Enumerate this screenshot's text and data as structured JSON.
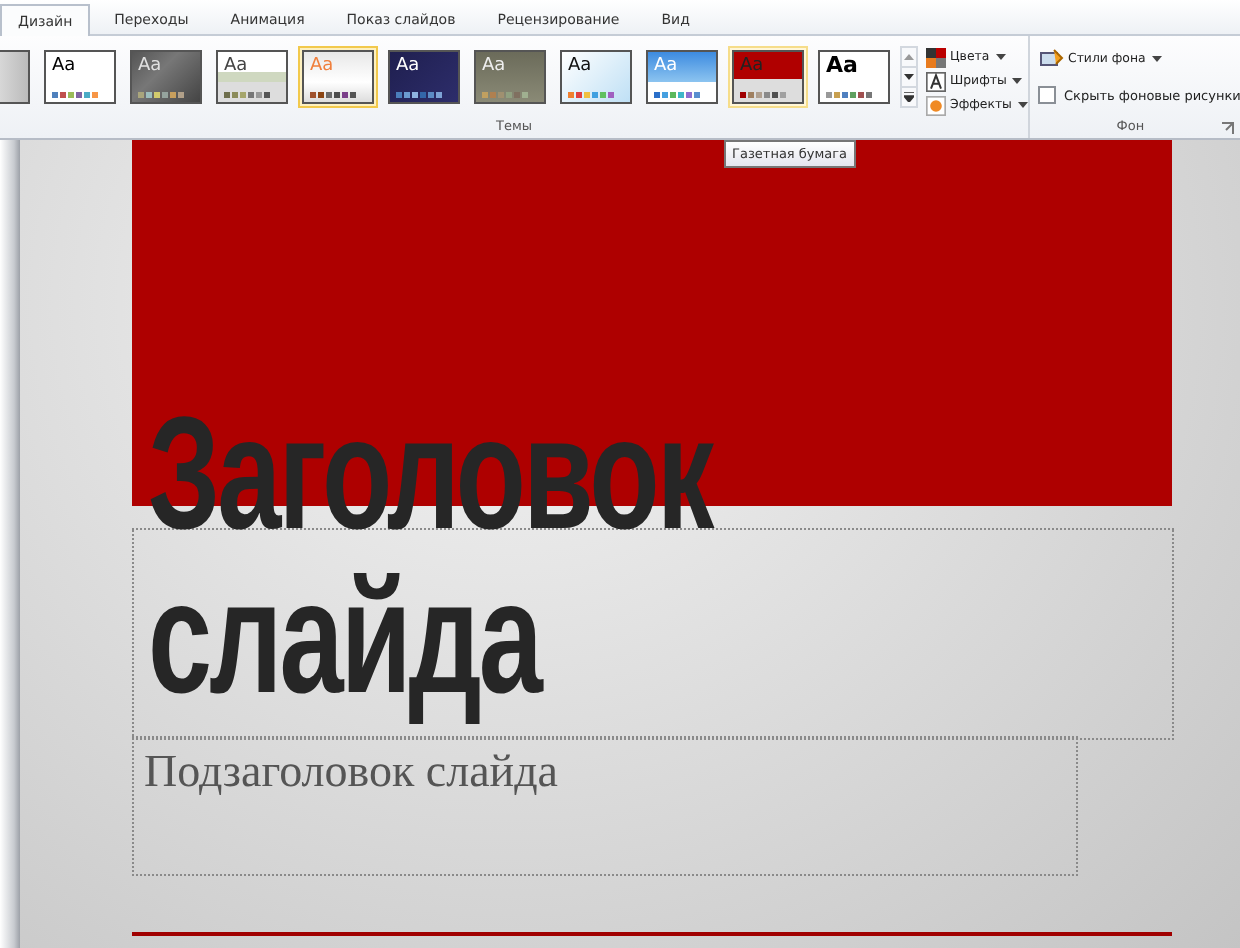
{
  "tabs": [
    {
      "label": "Дизайн",
      "selected": true
    },
    {
      "label": "Переходы",
      "selected": false
    },
    {
      "label": "Анимация",
      "selected": false
    },
    {
      "label": "Показ слайдов",
      "selected": false
    },
    {
      "label": "Рецензирование",
      "selected": false
    },
    {
      "label": "Вид",
      "selected": false
    }
  ],
  "themes": {
    "label": "Темы",
    "items": [
      {
        "kind": "fade",
        "selected": false,
        "hovered": false
      },
      {
        "kind": "white",
        "sample": "Aa",
        "selected": false,
        "hovered": false
      },
      {
        "kind": "smoke",
        "sample": "Aa",
        "selected": false,
        "hovered": false
      },
      {
        "kind": "bar",
        "sample": "Aa",
        "selected": false,
        "hovered": false
      },
      {
        "kind": "orange",
        "sample": "Aa",
        "selected": true,
        "hovered": false
      },
      {
        "kind": "navy",
        "sample": "Aa",
        "selected": false,
        "hovered": false
      },
      {
        "kind": "olive",
        "sample": "Aa",
        "selected": false,
        "hovered": false
      },
      {
        "kind": "sky",
        "sample": "Aa",
        "selected": false,
        "hovered": false
      },
      {
        "kind": "blue",
        "sample": "Aa",
        "selected": false,
        "hovered": false
      },
      {
        "kind": "red",
        "sample": "Aa",
        "selected": false,
        "hovered": true
      },
      {
        "kind": "bold",
        "sample": "Aa",
        "selected": false,
        "hovered": false
      }
    ],
    "commands": [
      {
        "kind": "colors",
        "label": "Цвета"
      },
      {
        "kind": "fonts",
        "label": "Шрифты"
      },
      {
        "kind": "effects",
        "label": "Эффекты"
      }
    ]
  },
  "background": {
    "label": "Фон",
    "styles_button": "Стили фона",
    "hide_graphics": {
      "label": "Скрыть фоновые рисунки",
      "checked": false
    }
  },
  "tooltip": "Газетная бумага",
  "slide": {
    "title": "Заголовок слайда",
    "subtitle": "Подзаголовок слайда"
  }
}
